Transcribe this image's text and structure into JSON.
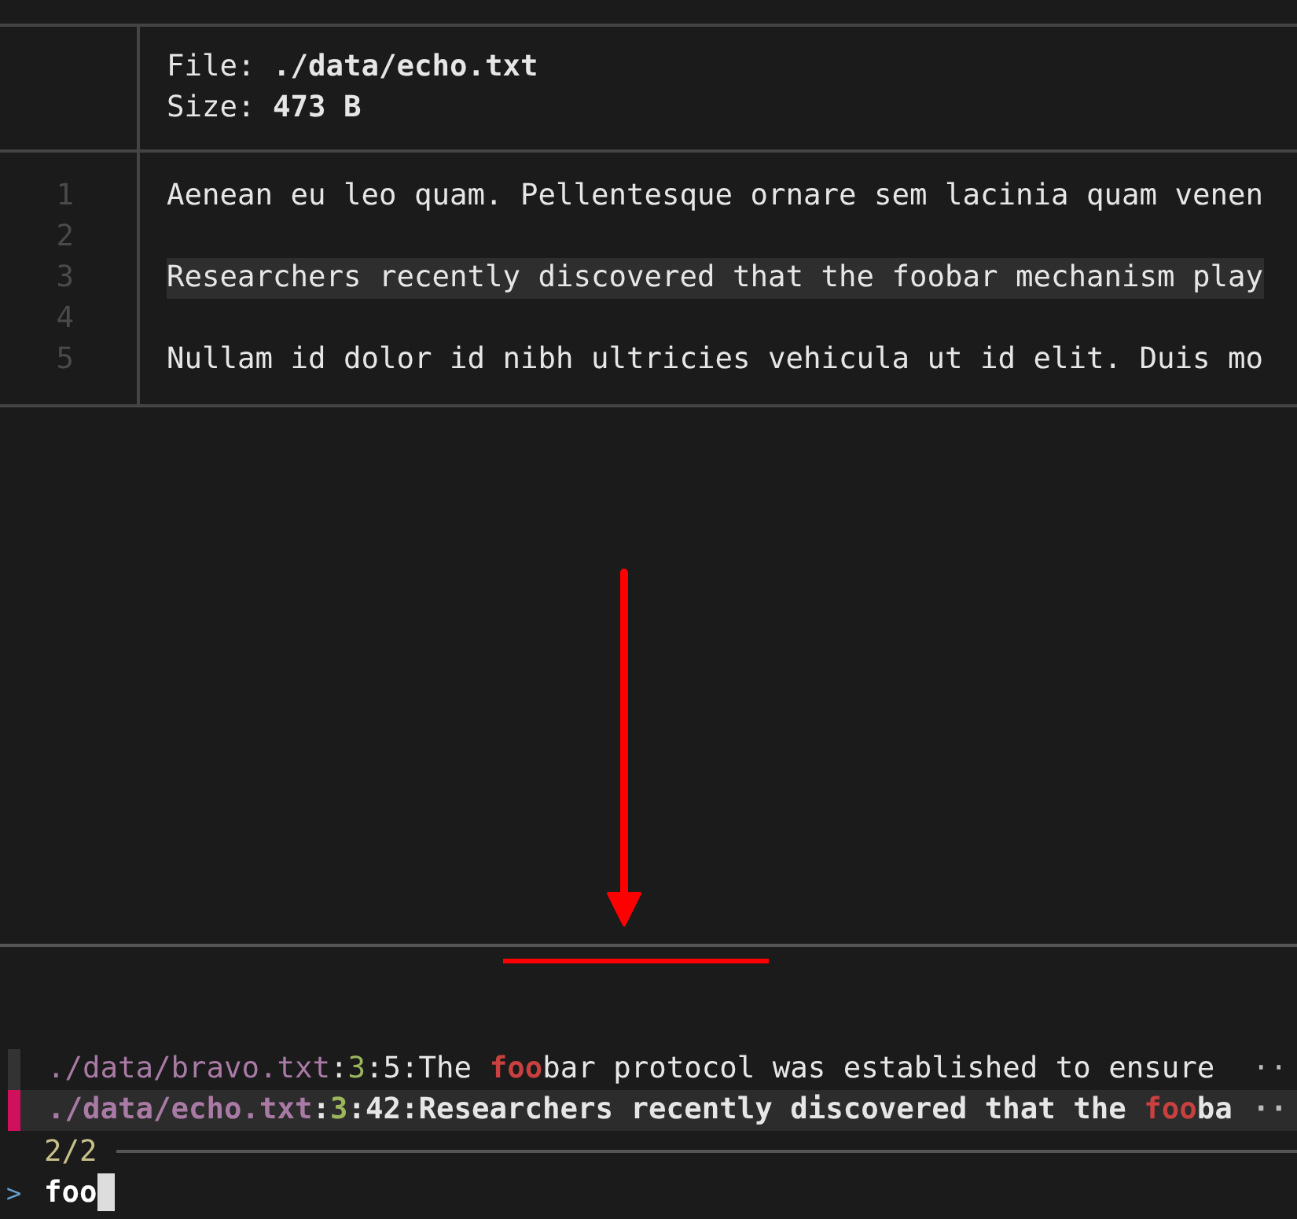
{
  "preview": {
    "header": [
      {
        "label": "File:",
        "value": "./data/echo.txt"
      },
      {
        "label": "Size:",
        "value": "473 B"
      }
    ],
    "lines": [
      {
        "number": "1",
        "text": "Aenean eu leo quam. Pellentesque ornare sem lacinia quam venen",
        "highlighted": false
      },
      {
        "number": "2"
      },
      {
        "number": "3",
        "text": "Researchers recently discovered that the foobar mechanism play",
        "highlighted": true
      },
      {
        "number": "4"
      },
      {
        "number": "5",
        "text": "Nullam id dolor id nibh ultricies vehicula ut id elit. Duis mo",
        "highlighted": false
      }
    ]
  },
  "results": [
    {
      "selected": false,
      "ellipsis": "··",
      "segments": [
        {
          "kind": "path",
          "text": "./data/bravo.txt"
        },
        {
          "kind": "plain",
          "text": ":"
        },
        {
          "kind": "line",
          "text": "3"
        },
        {
          "kind": "plain",
          "text": ":5:The "
        },
        {
          "kind": "match",
          "text": "foo"
        },
        {
          "kind": "plain",
          "text": "bar protocol was established to ensure"
        }
      ]
    },
    {
      "selected": true,
      "ellipsis": "··",
      "segments": [
        {
          "kind": "path",
          "text": "./data/echo.txt"
        },
        {
          "kind": "plain",
          "text": ":"
        },
        {
          "kind": "line",
          "text": "3"
        },
        {
          "kind": "plain",
          "text": ":42:Researchers recently discovered that the "
        },
        {
          "kind": "match",
          "text": "foo"
        },
        {
          "kind": "plain",
          "text": "ba"
        }
      ]
    }
  ],
  "count": "2/2",
  "prompt": {
    "symbol": ">",
    "value": "foo"
  }
}
